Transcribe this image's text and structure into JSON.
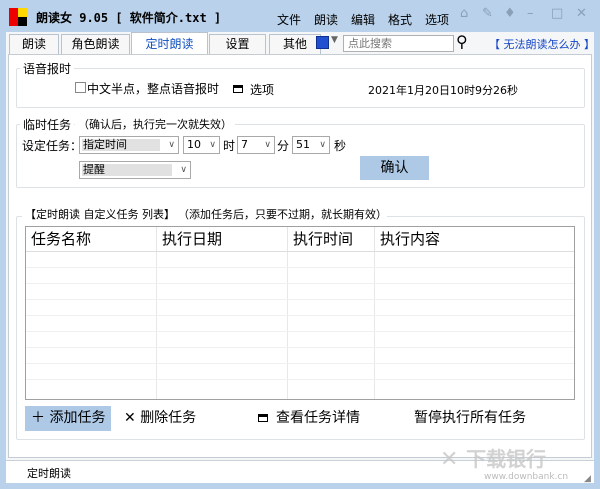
{
  "title": "朗读女 9.05 [ 软件简介.txt ]",
  "menu": [
    "文件",
    "朗读",
    "编辑",
    "格式",
    "选项"
  ],
  "tabs": [
    "朗读",
    "角色朗读",
    "定时朗读",
    "设置",
    "其他"
  ],
  "search": {
    "placeholder": "点此搜索"
  },
  "help_link": "【 无法朗读怎么办 】",
  "voice_group": {
    "label": "语音报时",
    "checkbox_label": "中文半点，整点语音报时",
    "checked": false,
    "options_label": "选项",
    "datetime": "2021年1月20日10时9分26秒"
  },
  "temp_group": {
    "label": "临时任务",
    "hint": "（确认后，执行完一次就失效）",
    "set_label": "设定任务：",
    "type": "指定时间",
    "hour": "10",
    "hour_unit": "时",
    "minute": "7",
    "minute_unit": "分",
    "second": "51",
    "second_unit": "秒",
    "action": "提醒",
    "confirm": "确认"
  },
  "list_group": {
    "label": "【定时朗读  自定义任务 列表】",
    "hint": "（添加任务后，只要不过期，就长期有效）",
    "columns": [
      "任务名称",
      "执行日期",
      "执行时间",
      "执行内容"
    ],
    "rows": []
  },
  "buttons": {
    "add": "添加任务",
    "delete": "删除任务",
    "details": "查看任务详情",
    "pause": "暂停执行所有任务"
  },
  "status": "定时朗读",
  "watermark": "下载银行 www.downbank.cn"
}
